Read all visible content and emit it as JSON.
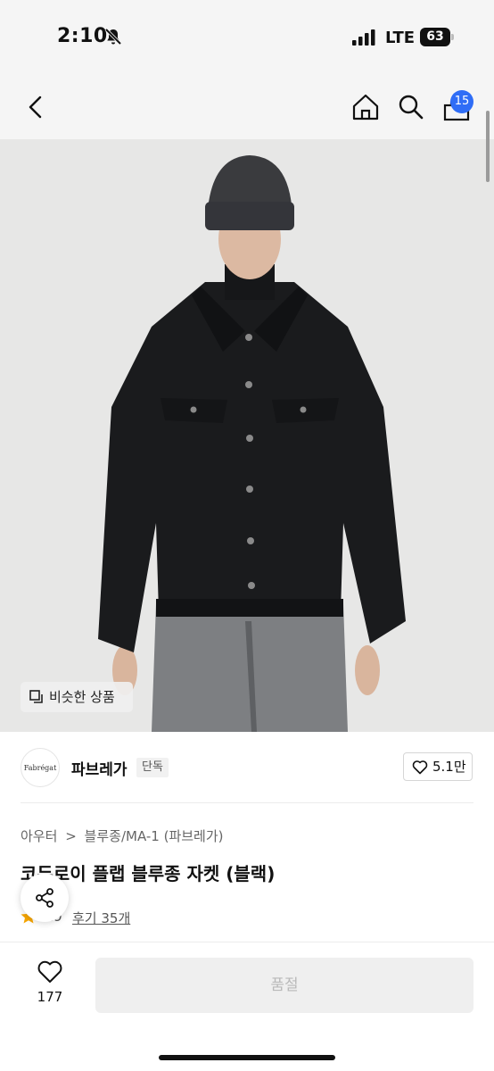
{
  "status": {
    "time": "2:10",
    "network": "LTE",
    "battery": "63"
  },
  "nav": {
    "cart_count": "15"
  },
  "hero": {
    "similar_label": "비슷한 상품"
  },
  "brand": {
    "logo_text": "Fabrégat",
    "name": "파브레가",
    "badge": "단독",
    "likes": "5.1만"
  },
  "breadcrumb": [
    "아우터",
    ">",
    "블루종/MA-1 (파브레가)"
  ],
  "product": {
    "title": "코듀로이 플랩 블루종 자켓 (블랙)",
    "rating": "4.9",
    "reviews": "후기 35개"
  },
  "bottom": {
    "wish_count": "177",
    "soldout_label": "품절"
  },
  "colors": {
    "accent": "#2f6df6",
    "star": "#f7a600"
  }
}
